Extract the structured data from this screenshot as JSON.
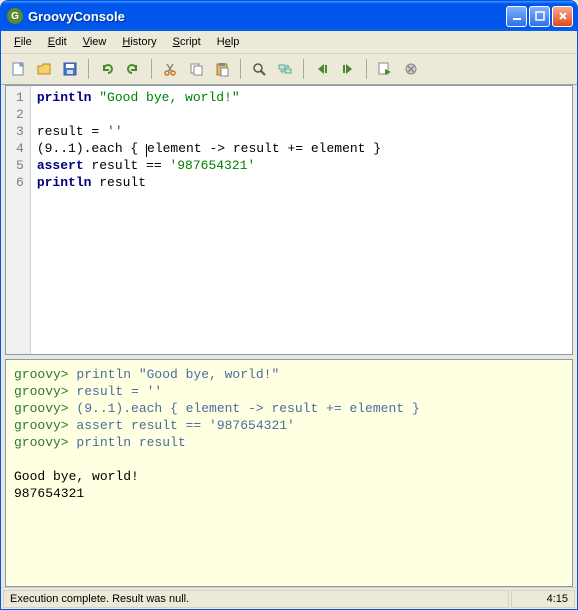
{
  "window": {
    "title": "GroovyConsole"
  },
  "menu": {
    "file": "File",
    "edileU": "F",
    "edit": "Edit",
    "view": "View",
    "history": "History",
    "script": "Script",
    "help": "Help"
  },
  "toolbar_icons": {
    "new": "new",
    "open": "open",
    "save": "save",
    "undo": "undo",
    "redo": "redo",
    "cut": "cut",
    "copy": "copy",
    "paste": "paste",
    "find": "find",
    "replace": "replace",
    "prev": "prev",
    "next": "next",
    "run": "run",
    "close": "close"
  },
  "code": {
    "line_count": 6,
    "l1_kw": "println",
    "l1_str": "\"Good bye, world!\"",
    "l3_a": "result = ",
    "l3_str": "''",
    "l4_a": "(9..1).each { ",
    "l4_b": "element -> result += element }",
    "l5_kw": "assert",
    "l5_a": " result == ",
    "l5_str": "'987654321'",
    "l6_kw": "println",
    "l6_a": " result"
  },
  "output": {
    "prompt": "groovy>",
    "e1": " println \"Good bye, world!\"",
    "e2": " result = ''",
    "e3": " (9..1).each { element -> result += element }",
    "e4": " assert result == '987654321'",
    "e5": " println result",
    "r1": "Good bye, world!",
    "r2": "987654321"
  },
  "status": {
    "left": "Execution complete. Result was null.",
    "right": "4:15"
  }
}
